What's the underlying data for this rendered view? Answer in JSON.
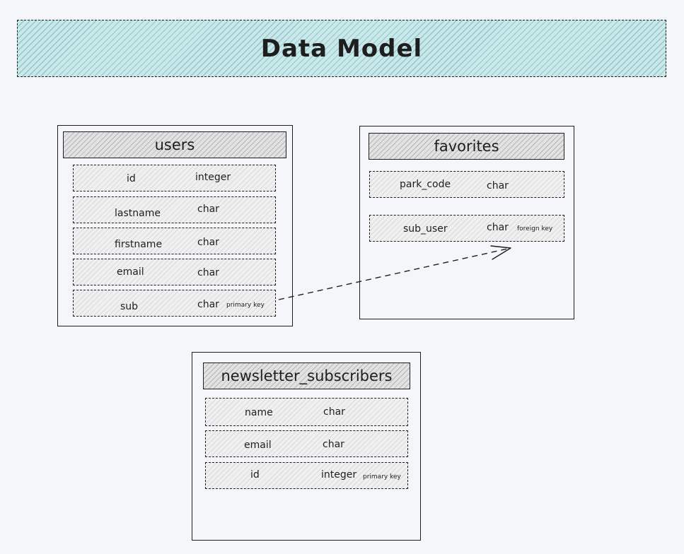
{
  "title": "Data Model",
  "tables": {
    "users": {
      "name": "users",
      "fields": [
        {
          "name": "id",
          "type": "integer",
          "note": ""
        },
        {
          "name": "lastname",
          "type": "char",
          "note": ""
        },
        {
          "name": "firstname",
          "type": "char",
          "note": ""
        },
        {
          "name": "email",
          "type": "char",
          "note": ""
        },
        {
          "name": "sub",
          "type": "char",
          "note": "primary key"
        }
      ]
    },
    "favorites": {
      "name": "favorites",
      "fields": [
        {
          "name": "park_code",
          "type": "char",
          "note": ""
        },
        {
          "name": "sub_user",
          "type": "char",
          "note": "foreign key"
        }
      ]
    },
    "newsletter": {
      "name": "newsletter_subscribers",
      "fields": [
        {
          "name": "name",
          "type": "char",
          "note": ""
        },
        {
          "name": "email",
          "type": "char",
          "note": ""
        },
        {
          "name": "id",
          "type": "integer",
          "note": "primary key"
        }
      ]
    }
  },
  "relationship": {
    "from": "users.sub",
    "to": "favorites.sub_user"
  },
  "colors": {
    "banner": "#c9e8ea",
    "header": "#e2e2e2",
    "stroke": "#1e1e1e",
    "background": "#f4f6f9"
  }
}
